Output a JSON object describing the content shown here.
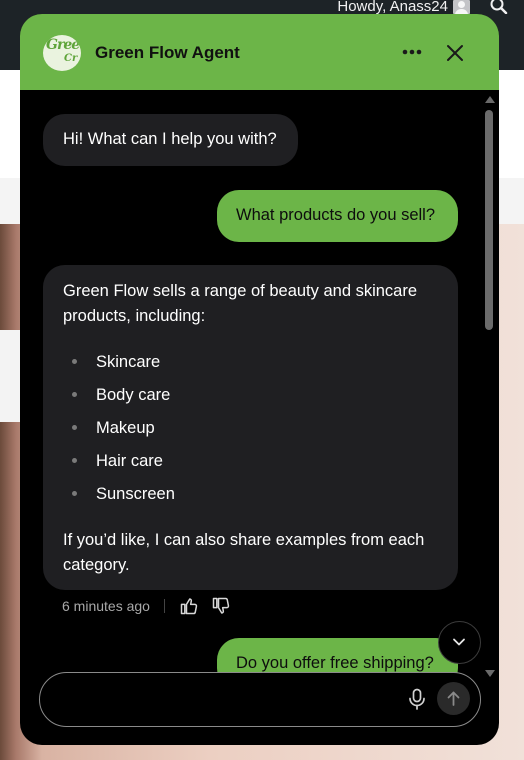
{
  "admin_bar": {
    "greeting": "Howdy, Anass24",
    "avatar_icon": "user-avatar-icon",
    "search_icon": "search-icon"
  },
  "widget": {
    "title": "Green Flow Agent",
    "logo": {
      "text": "Gree",
      "subtext": "Cr"
    },
    "more_icon": "more-horizontal-icon",
    "close_icon": "close-icon",
    "colors": {
      "accent": "#6cb548",
      "panel": "#000000",
      "bot_bubble": "#1f1f22"
    }
  },
  "messages": [
    {
      "role": "bot",
      "text": "Hi! What can I help you with?"
    },
    {
      "role": "user",
      "text": "What products do you sell?"
    },
    {
      "role": "bot",
      "intro": "Green Flow sells a range of beauty and skincare products, including:",
      "items": [
        "Skincare",
        "Body care",
        "Makeup",
        "Hair care",
        "Sunscreen"
      ],
      "outro": "If you’d like, I can also share examples from each category.",
      "time": "6 minutes ago"
    },
    {
      "role": "user",
      "text": "Do you offer free shipping?"
    }
  ],
  "feedback": {
    "like_icon": "thumbs-up-icon",
    "dislike_icon": "thumbs-down-icon"
  },
  "scroll_down_icon": "chevron-down-icon",
  "composer": {
    "value": "",
    "placeholder": "",
    "mic_icon": "microphone-icon",
    "send_icon": "arrow-up-icon"
  }
}
